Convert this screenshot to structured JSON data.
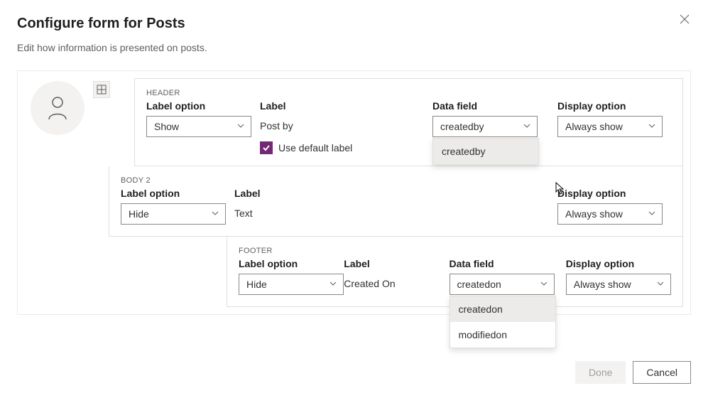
{
  "dialog": {
    "title": "Configure form for Posts",
    "subtitle": "Edit how information is presented on posts."
  },
  "sections": {
    "header": {
      "name": "HEADER",
      "label_option_heading": "Label option",
      "label_option_value": "Show",
      "label_heading": "Label",
      "label_value": "Post by",
      "use_default_label": "Use default label",
      "use_default_checked": true,
      "data_field_heading": "Data field",
      "data_field_value": "createdby",
      "data_field_options": [
        "createdby"
      ],
      "display_heading": "Display option",
      "display_value": "Always show"
    },
    "body": {
      "name": "BODY 2",
      "label_option_heading": "Label option",
      "label_option_value": "Hide",
      "label_heading": "Label",
      "label_value": "Text",
      "display_heading": "Display option",
      "display_value": "Always show"
    },
    "footer": {
      "name": "FOOTER",
      "label_option_heading": "Label option",
      "label_option_value": "Hide",
      "label_heading": "Label",
      "label_value": "Created On",
      "data_field_heading": "Data field",
      "data_field_value": "createdon",
      "data_field_options": [
        "createdon",
        "modifiedon"
      ],
      "display_heading": "Display option",
      "display_value": "Always show"
    }
  },
  "actions": {
    "done": "Done",
    "cancel": "Cancel"
  }
}
